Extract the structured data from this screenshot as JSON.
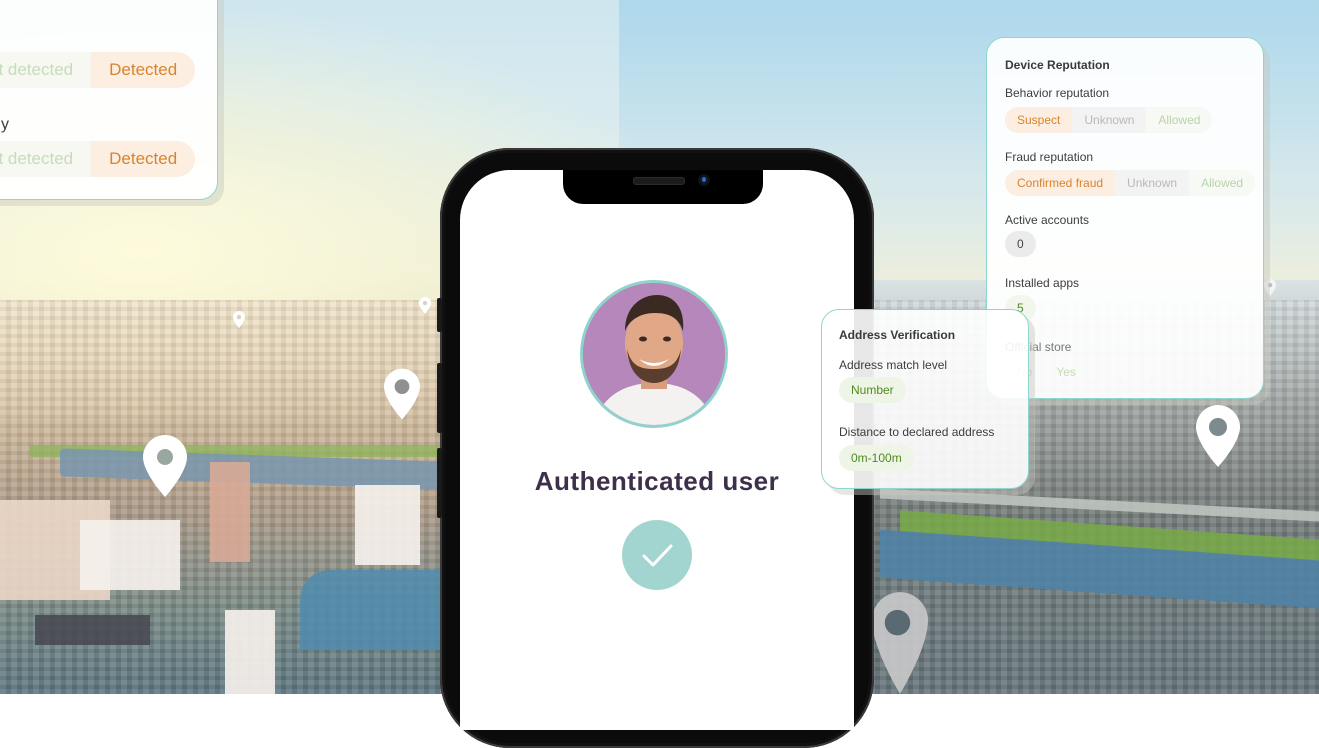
{
  "left_card": {
    "rows": [
      {
        "label": "",
        "options": [
          {
            "label": "ot detected",
            "state": "dim"
          },
          {
            "label": "Detected",
            "state": "selected"
          }
        ]
      },
      {
        "label": "y",
        "options": [
          {
            "label": "ot detected",
            "state": "dim"
          },
          {
            "label": "Detected",
            "state": "selected"
          }
        ]
      }
    ]
  },
  "phone": {
    "status_title": "Authenticated user",
    "status_icon": "check-icon",
    "avatar_alt": "user-avatar-photo"
  },
  "device_reputation": {
    "title": "Device Reputation",
    "behavior": {
      "label": "Behavior reputation",
      "options": [
        {
          "label": "Suspect",
          "state": "selected"
        },
        {
          "label": "Unknown",
          "state": "dim"
        },
        {
          "label": "Allowed",
          "state": "dim"
        }
      ]
    },
    "fraud": {
      "label": "Fraud reputation",
      "options": [
        {
          "label": "Confirmed fraud",
          "state": "selected"
        },
        {
          "label": "Unknown",
          "state": "dim"
        },
        {
          "label": "Allowed",
          "state": "dim"
        }
      ]
    },
    "active_accounts": {
      "label": "Active accounts",
      "value": "0"
    },
    "installed_apps": {
      "label": "Installed apps",
      "value": "5"
    },
    "official_store": {
      "label": "Official store",
      "options": [
        {
          "label": "No",
          "state": "selected"
        },
        {
          "label": "Yes",
          "state": "dim"
        }
      ]
    }
  },
  "address_verification": {
    "title": "Address Verification",
    "match_level": {
      "label": "Address match level",
      "value": "Number"
    },
    "distance": {
      "label": "Distance to declared address",
      "value": "0m-100m"
    }
  },
  "colors": {
    "accent_teal": "#8fd6cf",
    "selected_orange": "#d9832f",
    "positive_green": "#4f8a21",
    "title_purple": "#3e2f4a",
    "avatar_bg": "#b587ba",
    "check_bg": "#a3d5d0"
  }
}
